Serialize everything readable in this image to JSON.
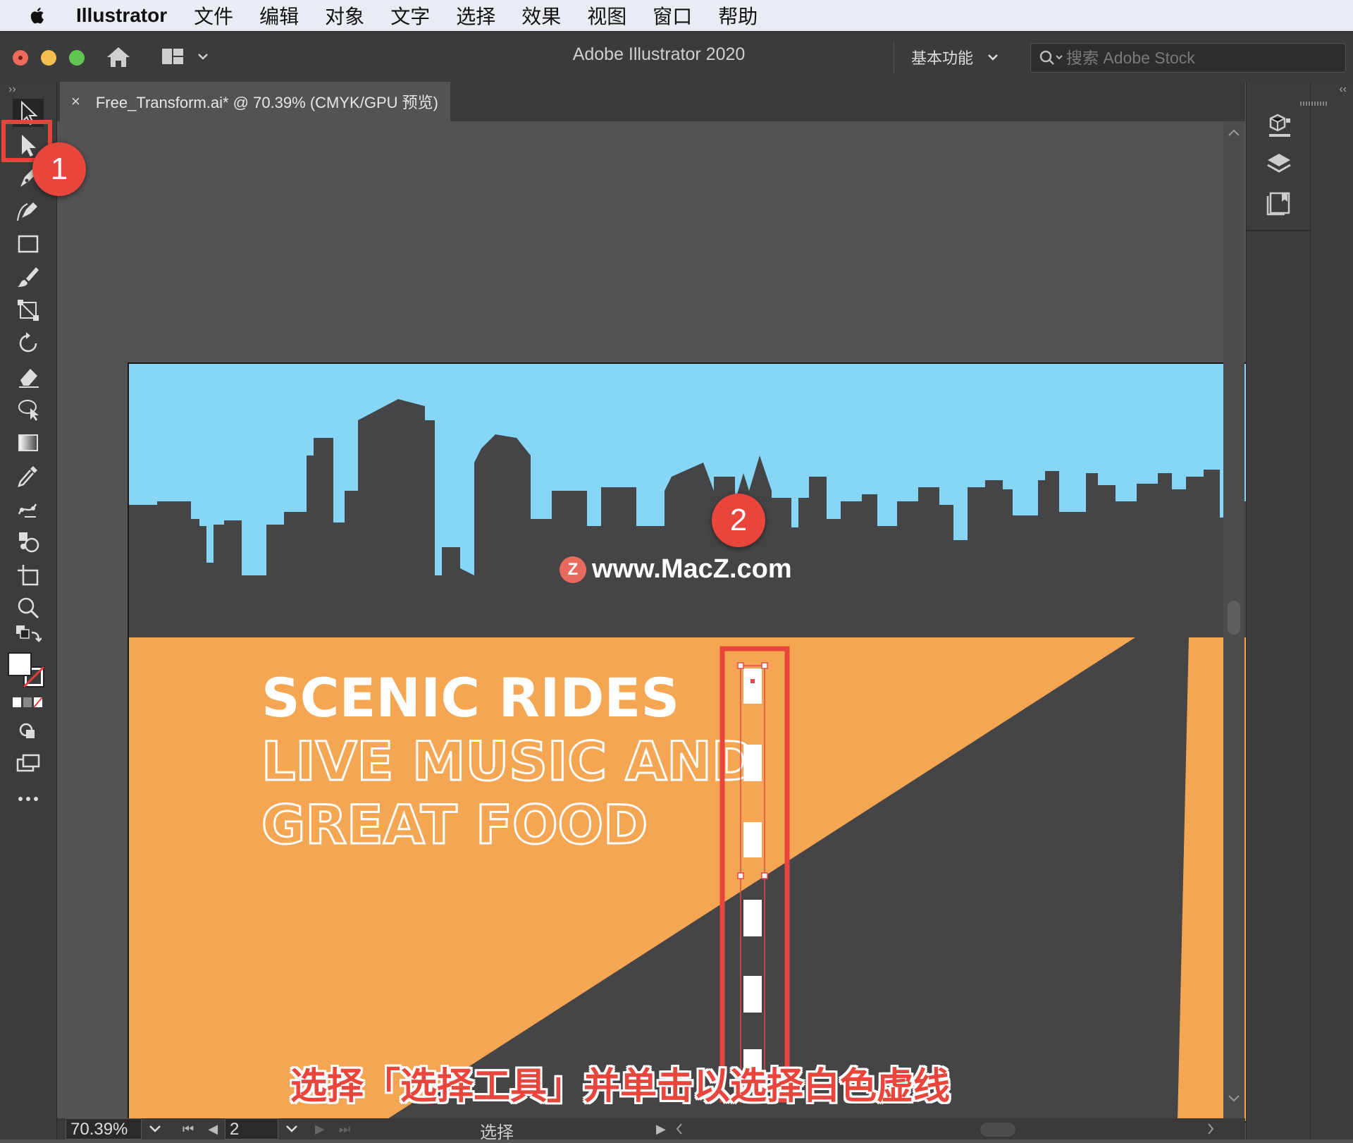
{
  "menubar": {
    "app": "Illustrator",
    "items": [
      "文件",
      "编辑",
      "对象",
      "文字",
      "选择",
      "效果",
      "视图",
      "窗口",
      "帮助"
    ]
  },
  "titlebar": {
    "title": "Adobe Illustrator 2020",
    "workspace": "基本功能",
    "stock_placeholder": "搜索 Adobe Stock"
  },
  "document": {
    "tab_label": "Free_Transform.ai* @ 70.39% (CMYK/GPU 预览)",
    "close_glyph": "×"
  },
  "artwork": {
    "line1": "SCENIC RIDES",
    "line2": "LIVE MUSIC AND",
    "line3": "GREAT FOOD",
    "sky_color": "#87d6f5",
    "ground_color": "#f5a653",
    "road_color": "#454547"
  },
  "statusbar": {
    "zoom": "70.39%",
    "artboard": "2",
    "status": "选择"
  },
  "annotations": {
    "callout1": "1",
    "callout2": "2",
    "caption": "选择「选择工具」并单击以选择白色虚线",
    "watermark": "www.MacZ.com",
    "watermark_badge": "Z",
    "accent": "#e8453c"
  }
}
